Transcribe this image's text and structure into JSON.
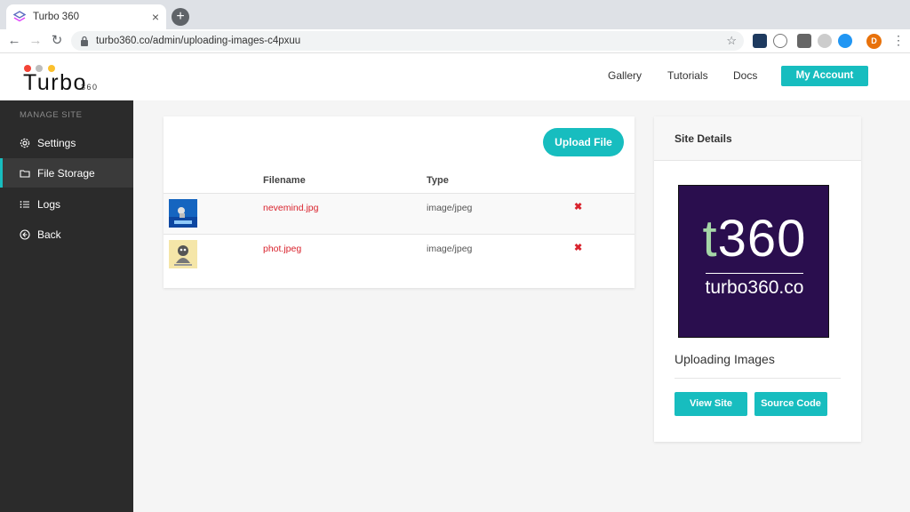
{
  "browser": {
    "tab_title": "Turbo 360",
    "url": "turbo360.co/admin/uploading-images-c4pxuu",
    "profile_initial": "D"
  },
  "header": {
    "logo_text": "Turbo",
    "logo_sub": "360",
    "nav": [
      "Gallery",
      "Tutorials",
      "Docs"
    ],
    "account_label": "My Account"
  },
  "sidebar": {
    "heading": "MANAGE SITE",
    "items": [
      {
        "label": "Settings",
        "icon": "gear-icon"
      },
      {
        "label": "File Storage",
        "icon": "folder-icon"
      },
      {
        "label": "Logs",
        "icon": "list-icon"
      },
      {
        "label": "Back",
        "icon": "back-circle-icon"
      }
    ]
  },
  "files": {
    "upload_label": "Upload File",
    "columns": {
      "filename": "Filename",
      "type": "Type"
    },
    "delete_glyph": "✖",
    "rows": [
      {
        "filename": "nevemind.jpg",
        "type": "image/jpeg"
      },
      {
        "filename": "phot.jpeg",
        "type": "image/jpeg"
      }
    ]
  },
  "details": {
    "title": "Site Details",
    "image_big_t": "t",
    "image_big_rest": "360",
    "image_small": "turbo360.co",
    "site_name": "Uploading Images",
    "view_label": "View Site",
    "source_label": "Source Code"
  },
  "colors": {
    "accent": "#17bdbf",
    "sidebar_bg": "#2b2b2b",
    "link_red": "#d9232d",
    "logo_purple": "#2a0e4e"
  }
}
